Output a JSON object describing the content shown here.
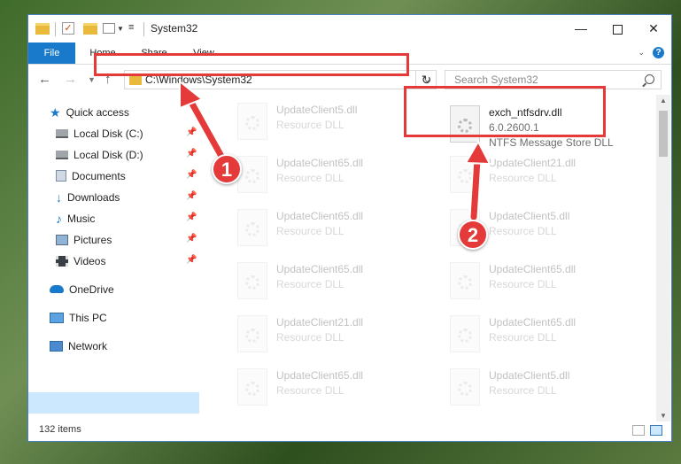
{
  "window": {
    "title": "System32",
    "controls": {
      "minimize": "—",
      "close": "✕"
    }
  },
  "ribbon": {
    "tabs": [
      {
        "label": "File"
      },
      {
        "label": "Home"
      },
      {
        "label": "Share"
      },
      {
        "label": "View"
      }
    ],
    "help": "?"
  },
  "navigation": {
    "address": "C:\\Windows\\System32",
    "search_placeholder": "Search System32"
  },
  "sidebar": {
    "items": [
      {
        "label": "Quick access",
        "icon": "star-icon"
      },
      {
        "label": "Local Disk (C:)",
        "icon": "drive-icon",
        "pinned": true
      },
      {
        "label": "Local Disk (D:)",
        "icon": "drive-icon",
        "pinned": true
      },
      {
        "label": "Documents",
        "icon": "documents-icon",
        "pinned": true
      },
      {
        "label": "Downloads",
        "icon": "download-icon",
        "pinned": true
      },
      {
        "label": "Music",
        "icon": "music-icon",
        "pinned": true
      },
      {
        "label": "Pictures",
        "icon": "pictures-icon",
        "pinned": true
      },
      {
        "label": "Videos",
        "icon": "videos-icon",
        "pinned": true
      },
      {
        "label": "OneDrive",
        "icon": "cloud-icon"
      },
      {
        "label": "This PC",
        "icon": "computer-icon",
        "selected": true
      },
      {
        "label": "Network",
        "icon": "network-icon"
      }
    ]
  },
  "files": {
    "left": [
      {
        "name": "UpdateClient5.dll",
        "desc": "Resource DLL"
      },
      {
        "name": "UpdateClient65.dll",
        "desc": "Resource DLL"
      },
      {
        "name": "UpdateClient65.dll",
        "desc": "Resource DLL"
      },
      {
        "name": "UpdateClient65.dll",
        "desc": "Resource DLL"
      },
      {
        "name": "UpdateClient21.dll",
        "desc": "Resource DLL"
      },
      {
        "name": "UpdateClient65.dll",
        "desc": "Resource DLL"
      }
    ],
    "right": [
      {
        "name": "UpdateClient21.dll",
        "desc": "Resource DLL"
      },
      {
        "name": "UpdateClient5.dll",
        "desc": "Resource DLL"
      },
      {
        "name": "UpdateClient65.dll",
        "desc": "Resource DLL"
      },
      {
        "name": "UpdateClient65.dll",
        "desc": "Resource DLL"
      },
      {
        "name": "UpdateClient5.dll",
        "desc": "Resource DLL"
      }
    ],
    "highlighted": {
      "name": "exch_ntfsdrv.dll",
      "version": "6.0.2600.1",
      "desc": "NTFS Message Store DLL"
    }
  },
  "status": {
    "items": "132 items"
  },
  "annotations": {
    "badge1": "1",
    "badge2": "2",
    "color": "#e43a3a"
  }
}
